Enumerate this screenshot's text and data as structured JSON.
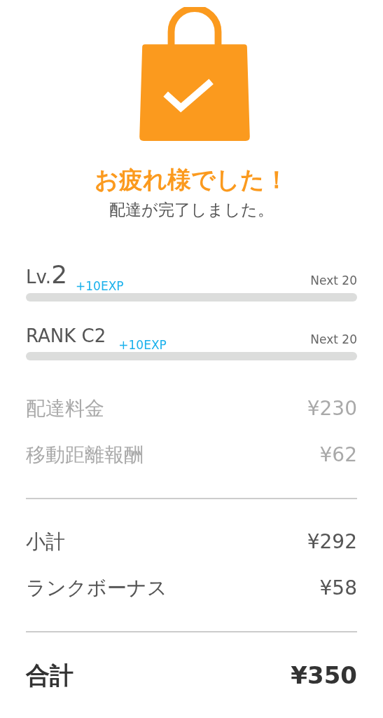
{
  "header": {
    "title": "お疲れ様でした！",
    "subtitle": "配達が完了しました。"
  },
  "progress": [
    {
      "kind": "level",
      "label": "Lv.",
      "value": "2",
      "exp": "+10EXP",
      "next": "Next 20",
      "level": 0
    },
    {
      "kind": "rank",
      "label": "RANK C2",
      "exp": "+10EXP",
      "next": "Next 20",
      "level": 0
    }
  ],
  "sections": [
    {
      "kind": "fees",
      "rows": [
        {
          "label": "配達料金",
          "amount": "¥230"
        },
        {
          "label": "移動距離報酬",
          "amount": "¥62"
        }
      ]
    },
    {
      "kind": "subtotal",
      "rows": [
        {
          "label": "小計",
          "amount": "¥292"
        },
        {
          "label": "ランクボーナス",
          "amount": "¥58"
        }
      ]
    },
    {
      "kind": "total",
      "rows": [
        {
          "label": "合計",
          "amount": "¥350"
        }
      ]
    }
  ]
}
